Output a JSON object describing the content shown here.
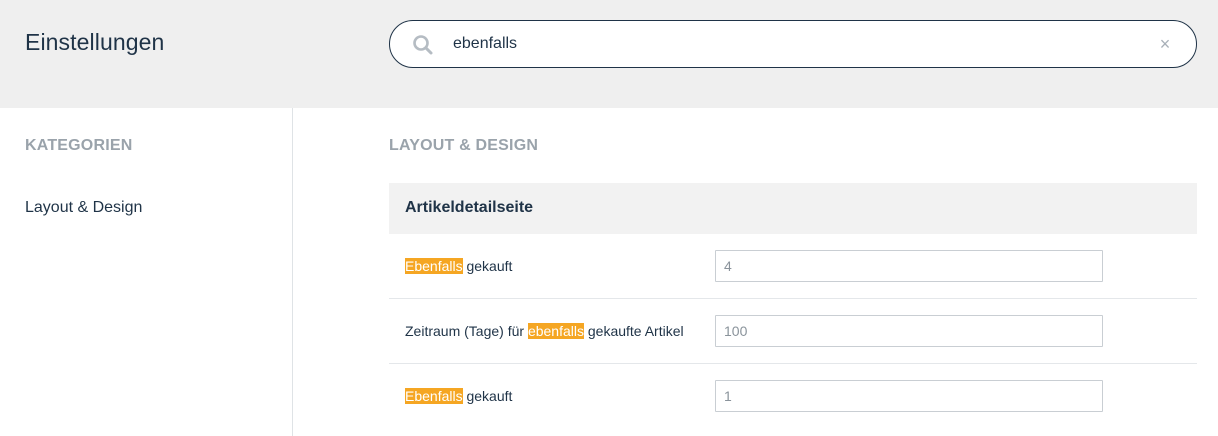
{
  "header": {
    "title": "Einstellungen",
    "search": {
      "value": "ebenfalls",
      "search_icon": "search-icon",
      "clear_icon": "close-icon",
      "clear_glyph": "×"
    }
  },
  "sidebar": {
    "heading": "KATEGORIEN",
    "items": [
      {
        "label": "Layout & Design"
      }
    ]
  },
  "main": {
    "heading": "LAYOUT & DESIGN",
    "group": {
      "title": "Artikeldetailseite",
      "rows": [
        {
          "prefix": "",
          "highlight": "Ebenfalls",
          "suffix": " gekauft",
          "value": "4"
        },
        {
          "prefix": "Zeitraum (Tage) für ",
          "highlight": "ebenfalls",
          "suffix": " gekaufte Artikel",
          "value": "100"
        },
        {
          "prefix": "",
          "highlight": "Ebenfalls",
          "suffix": " gekauft",
          "value": "1"
        }
      ]
    }
  },
  "colors": {
    "highlight": "#f5a623",
    "header_bg": "#efefef",
    "text_dark": "#1f3347",
    "muted_heading": "#9aa3ab"
  }
}
